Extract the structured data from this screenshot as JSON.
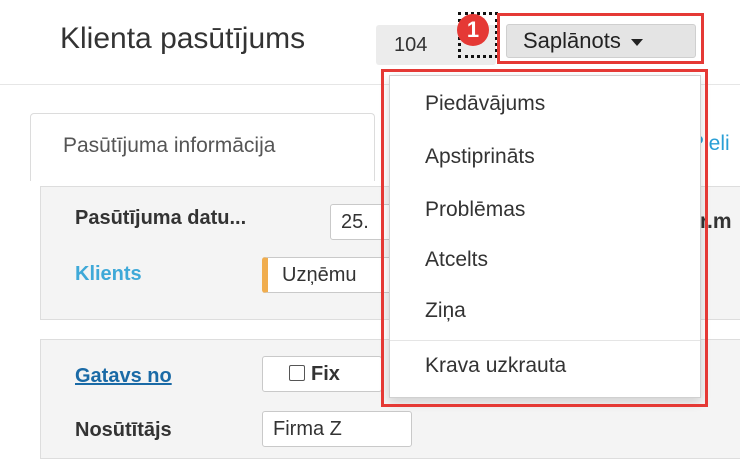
{
  "header": {
    "title": "Klienta pasūtījums",
    "order_number": "104",
    "marker_number": "1",
    "status_label": "Saplānots"
  },
  "tabs": [
    {
      "label": "Pasūtījuma informācija"
    },
    {
      "label": "Pieli"
    }
  ],
  "form": {
    "order_date_label": "Pasūtījuma datu...",
    "order_date_value": "25.",
    "partial_text": "r.m",
    "client_label": "Klients",
    "client_value": "Uzņēmu",
    "ready_from_label": "Gatavs no",
    "fix_label": "Fix",
    "sender_label": "Nosūtītājs",
    "sender_value": "Firma Z"
  },
  "status_menu": {
    "items": [
      "Piedāvājums",
      "Apstiprināts",
      "Problēmas",
      "Atcelts",
      "Ziņa",
      "Krava uzkrauta"
    ]
  },
  "colors": {
    "highlight": "#e53935",
    "link": "#1a6aa6",
    "client_label": "#3fa9d8",
    "required_marker": "#f0ad4e"
  }
}
